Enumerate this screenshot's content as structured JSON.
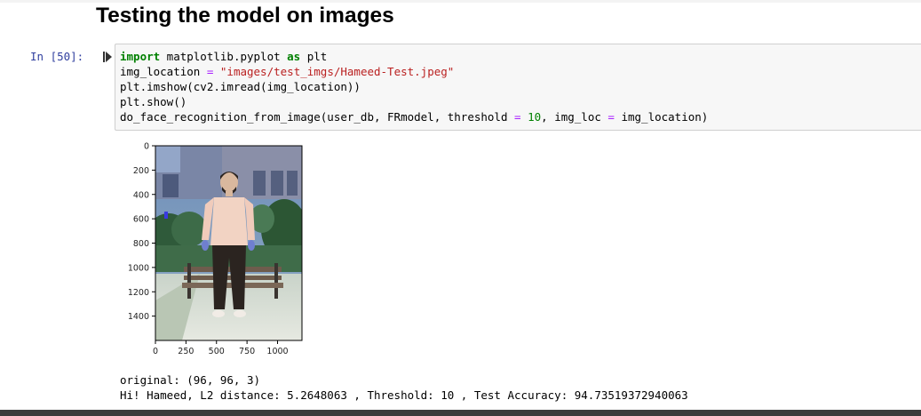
{
  "heading": "Testing the model on images",
  "cell": {
    "prompt": "In [50]:",
    "code_lines": [
      "import matplotlib.pyplot as plt",
      "img_location = \"images/test_imgs/Hameed-Test.jpeg\"",
      "plt.imshow(cv2.imread(img_location))",
      "plt.show()",
      "do_face_recognition_from_image(user_db, FRmodel, threshold = 10, img_loc = img_location)"
    ]
  },
  "plot": {
    "y_tick_labels": [
      "0",
      "200",
      "400",
      "600",
      "800",
      "1000",
      "1200",
      "1400"
    ],
    "x_tick_labels": [
      "0",
      "250",
      "500",
      "750",
      "1000"
    ],
    "y_ticks": [
      0,
      200,
      400,
      600,
      800,
      1000,
      1200,
      1400
    ],
    "x_ticks": [
      0,
      250,
      500,
      750,
      1000
    ],
    "x_range": [
      0,
      1200
    ],
    "y_range": [
      0,
      1600
    ]
  },
  "output": {
    "line1": "original: (96, 96, 3)",
    "line2": "Hi! Hameed, L2 distance: 5.2648063 , Threshold: 10 , Test Accuracy: 94.73519372940063"
  },
  "colors": {
    "prompt": "#303f9f",
    "keyword": "#008000",
    "string": "#ba2121",
    "operator": "#aa22ff"
  }
}
